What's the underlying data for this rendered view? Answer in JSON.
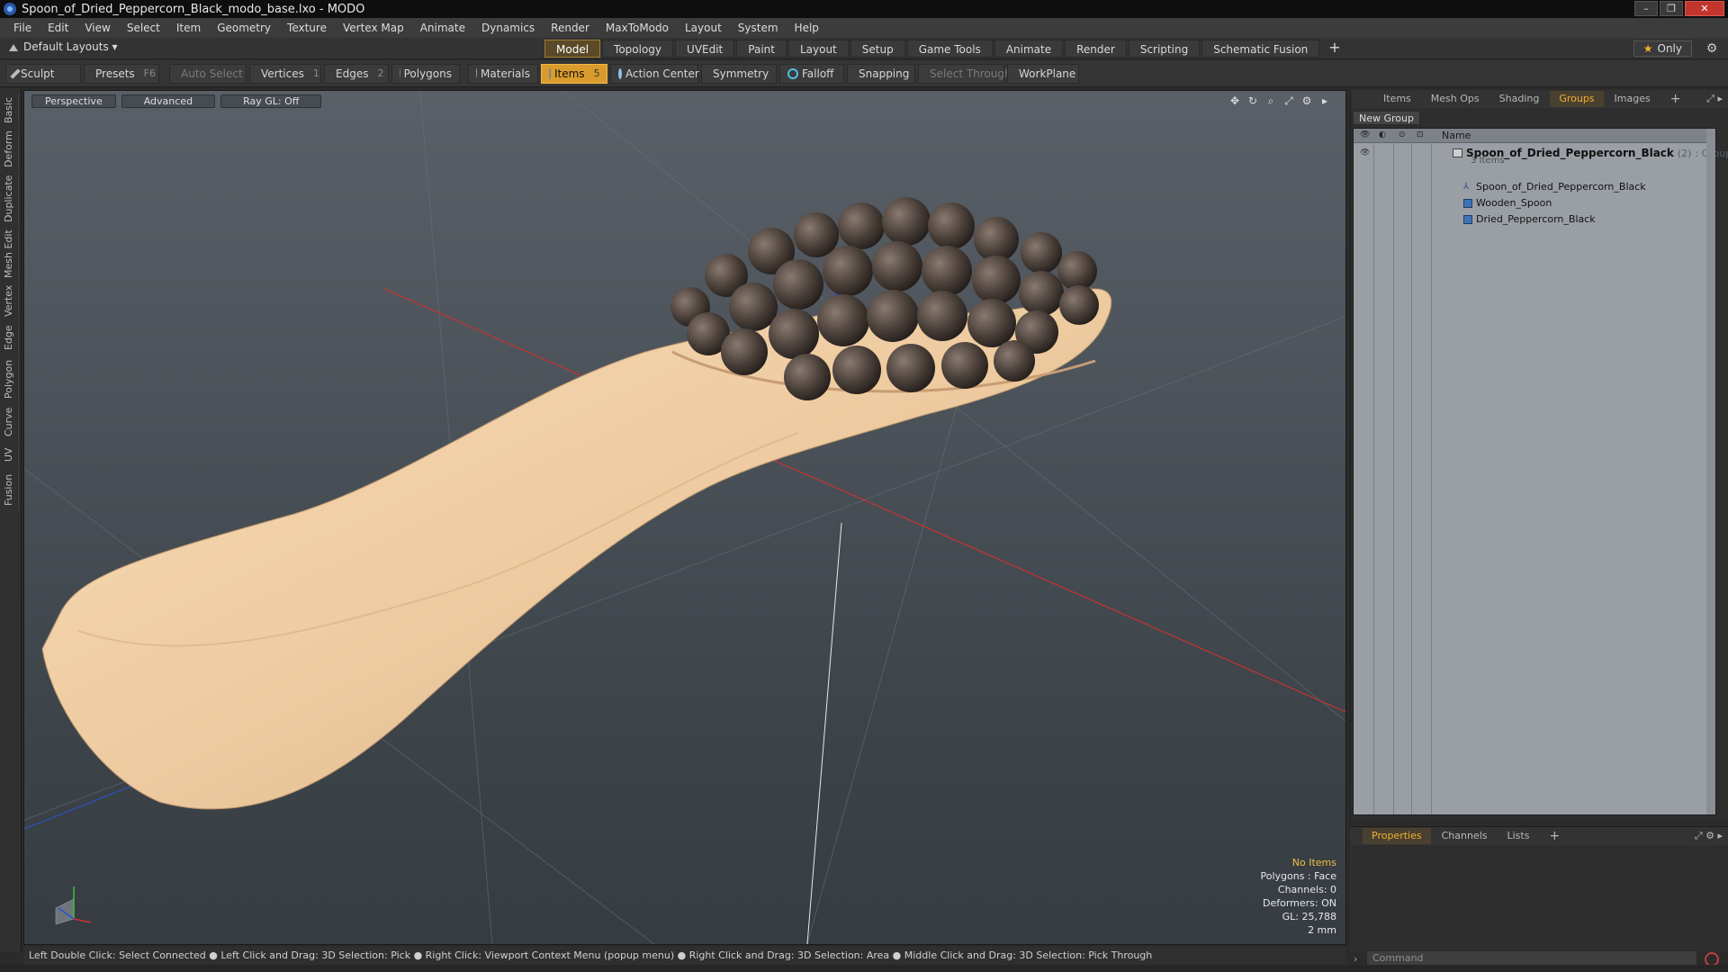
{
  "window": {
    "title": "Spoon_of_Dried_Peppercorn_Black_modo_base.lxo - MODO",
    "minimize": "–",
    "maximize": "❐",
    "close": "✕"
  },
  "menu": [
    "File",
    "Edit",
    "View",
    "Select",
    "Item",
    "Geometry",
    "Texture",
    "Vertex Map",
    "Animate",
    "Dynamics",
    "Render",
    "MaxToModo",
    "Layout",
    "System",
    "Help"
  ],
  "layout_bar": {
    "dropdown": "Default Layouts ▾",
    "tabs": [
      "Model",
      "Topology",
      "UVEdit",
      "Paint",
      "Layout",
      "Setup",
      "Game Tools",
      "Animate",
      "Render",
      "Scripting",
      "Schematic Fusion"
    ],
    "active_tab": "Model",
    "plus": "+",
    "only": "Only"
  },
  "toolbar": {
    "sculpt": "Sculpt",
    "presets": "Presets",
    "presets_key": "F6",
    "auto_select": "Auto Select",
    "vertices": "Vertices",
    "vertices_count": "1",
    "edges": "Edges",
    "edges_count": "2",
    "polygons": "Polygons",
    "materials": "Materials",
    "items": "Items",
    "items_count": "5",
    "action_center": "Action Center",
    "symmetry": "Symmetry",
    "falloff": "Falloff",
    "snapping": "Snapping",
    "select_through": "Select Through",
    "workplane": "WorkPlane"
  },
  "left_tabs": [
    "Basic",
    "Deform",
    "Duplicate",
    "Mesh Edit",
    "Vertex",
    "Edge",
    "Polygon",
    "Curve",
    "UV",
    "Fusion"
  ],
  "viewport": {
    "view": "Perspective",
    "shading": "Advanced",
    "raygl": "Ray GL: Off",
    "info": {
      "items": "No Items",
      "polygons": "Polygons : Face",
      "channels": "Channels: 0",
      "deformers": "Deformers: ON",
      "gl": "GL: 25,788",
      "unit": "2 mm"
    },
    "colors": {
      "wood_light": "#f2d2ab",
      "wood_dark": "#c9a27a",
      "pepper": "#4a403a"
    }
  },
  "right_panel": {
    "tabs": [
      "Items",
      "Mesh Ops",
      "Shading",
      "Groups",
      "Images"
    ],
    "active_tab": "Groups",
    "plus": "+",
    "new_group": "New Group",
    "column_name": "Name",
    "group": {
      "name": "Spoon_of_Dried_Peppercorn_Black",
      "count": "(2)",
      "type": ": Group",
      "sub": "3 Items"
    },
    "children": [
      "Spoon_of_Dried_Peppercorn_Black",
      "Wooden_Spoon",
      "Dried_Peppercorn_Black"
    ]
  },
  "properties_panel": {
    "tabs": [
      "Properties",
      "Channels",
      "Lists"
    ],
    "active_tab": "Properties",
    "plus": "+",
    "command_placeholder": "Command"
  },
  "status": "Left Double Click: Select Connected ● Left Click and Drag: 3D Selection: Pick ● Right Click: Viewport Context Menu (popup menu) ● Right Click and Drag: 3D Selection: Area ● Middle Click and Drag: 3D Selection: Pick Through"
}
